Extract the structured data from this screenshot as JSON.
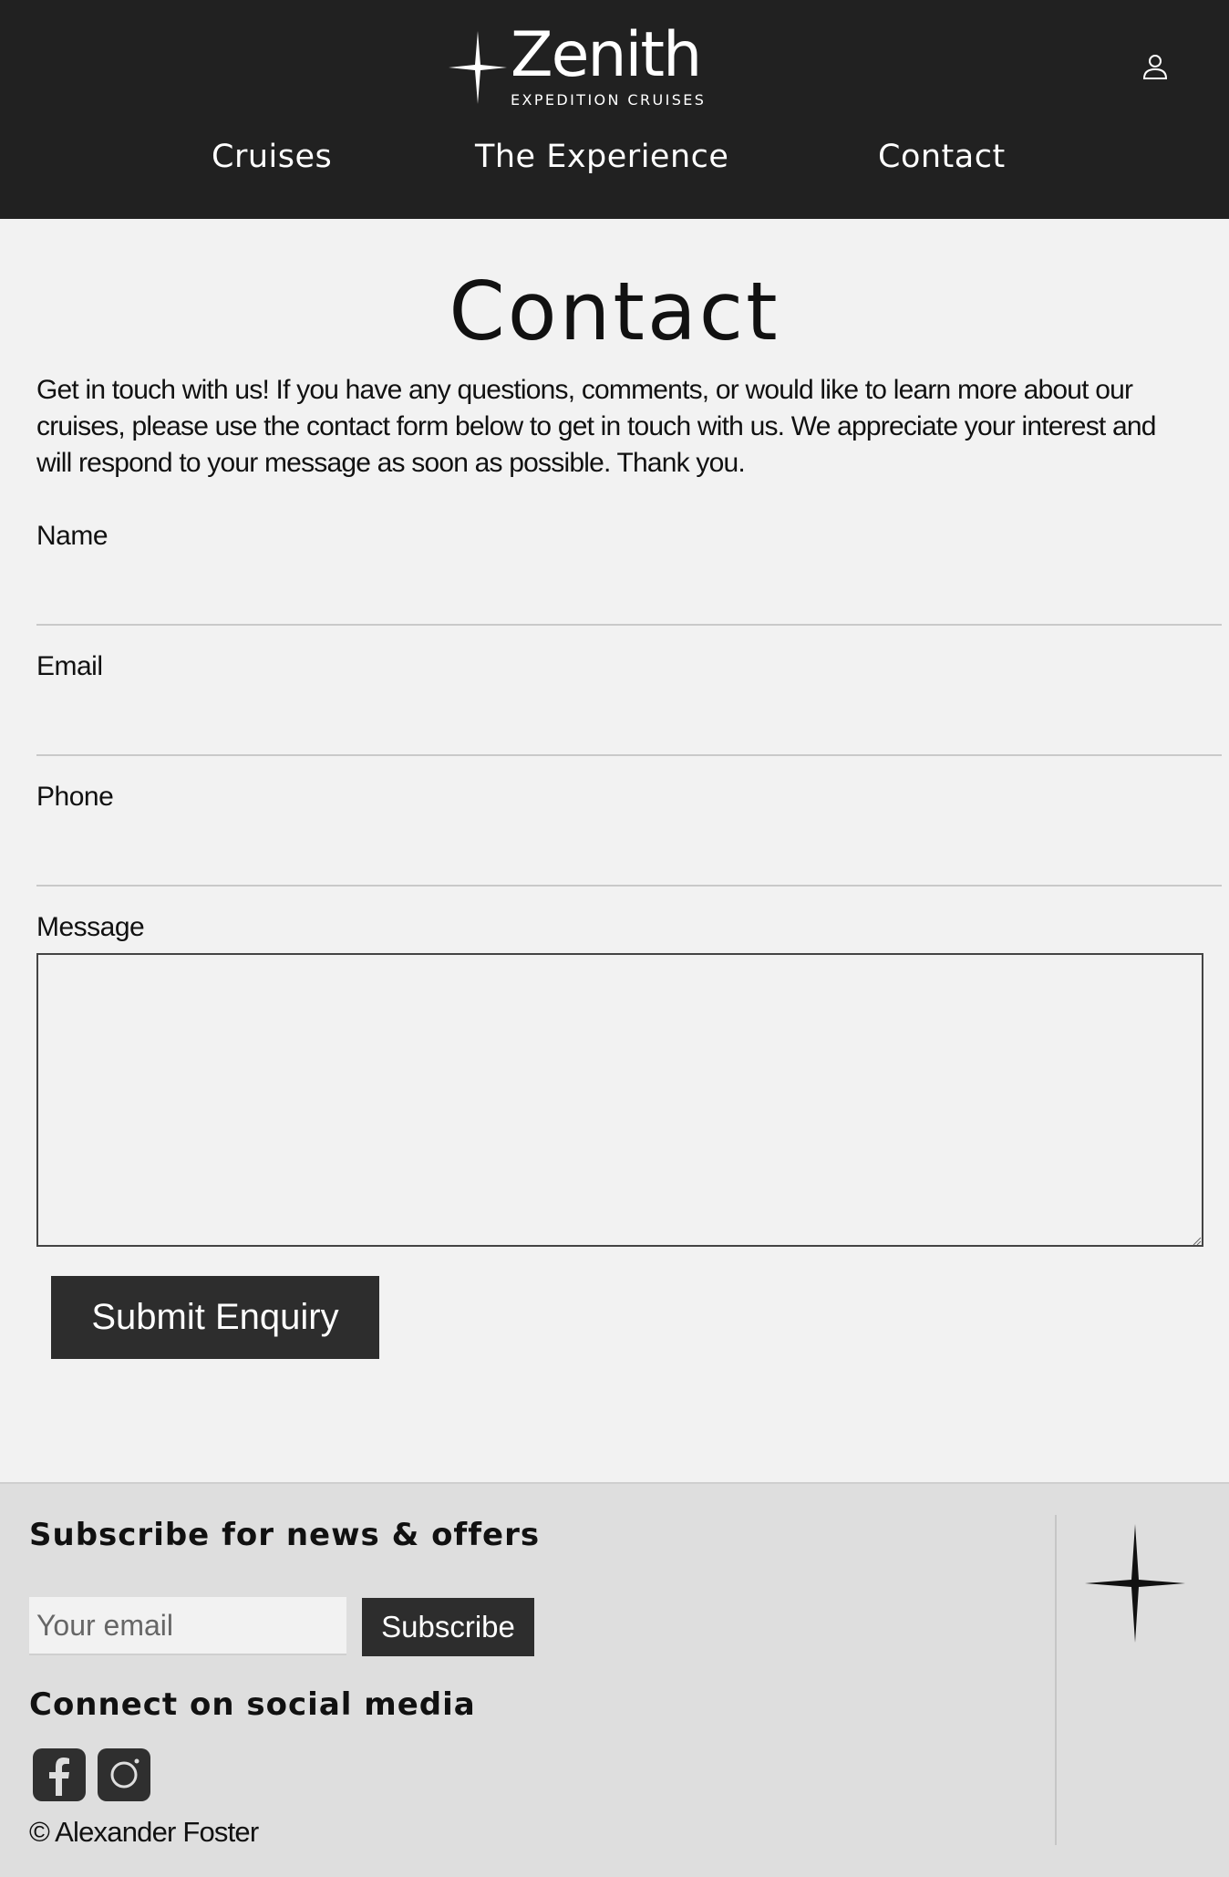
{
  "header": {
    "brand_name": "Zenith",
    "brand_tagline": "EXPEDITION CRUISES",
    "nav": [
      {
        "label": "Cruises"
      },
      {
        "label": "The Experience"
      },
      {
        "label": "Contact"
      }
    ],
    "account_icon": "user-icon"
  },
  "main": {
    "title": "Contact",
    "intro": "Get in touch with us! If you have any questions, comments, or would like to learn more about our cruises, please use the contact form below to get in touch with us. We appreciate your interest and will respond to your message as soon as possible. Thank you.",
    "form": {
      "name_label": "Name",
      "name_value": "",
      "email_label": "Email",
      "email_value": "",
      "phone_label": "Phone",
      "phone_value": "",
      "message_label": "Message",
      "message_value": "",
      "submit_label": "Submit Enquiry"
    }
  },
  "footer": {
    "subscribe_title": "Subscribe for news & offers",
    "email_placeholder": "Your email",
    "subscribe_label": "Subscribe",
    "social_title": "Connect on social media",
    "social": [
      {
        "icon": "facebook-icon"
      },
      {
        "icon": "instagram-icon"
      }
    ],
    "copyright": "© Alexander Foster"
  },
  "colors": {
    "header_bg": "#212121",
    "page_bg": "#f2f2f2",
    "footer_bg": "#dedede",
    "button_bg": "#2d2d2d"
  }
}
